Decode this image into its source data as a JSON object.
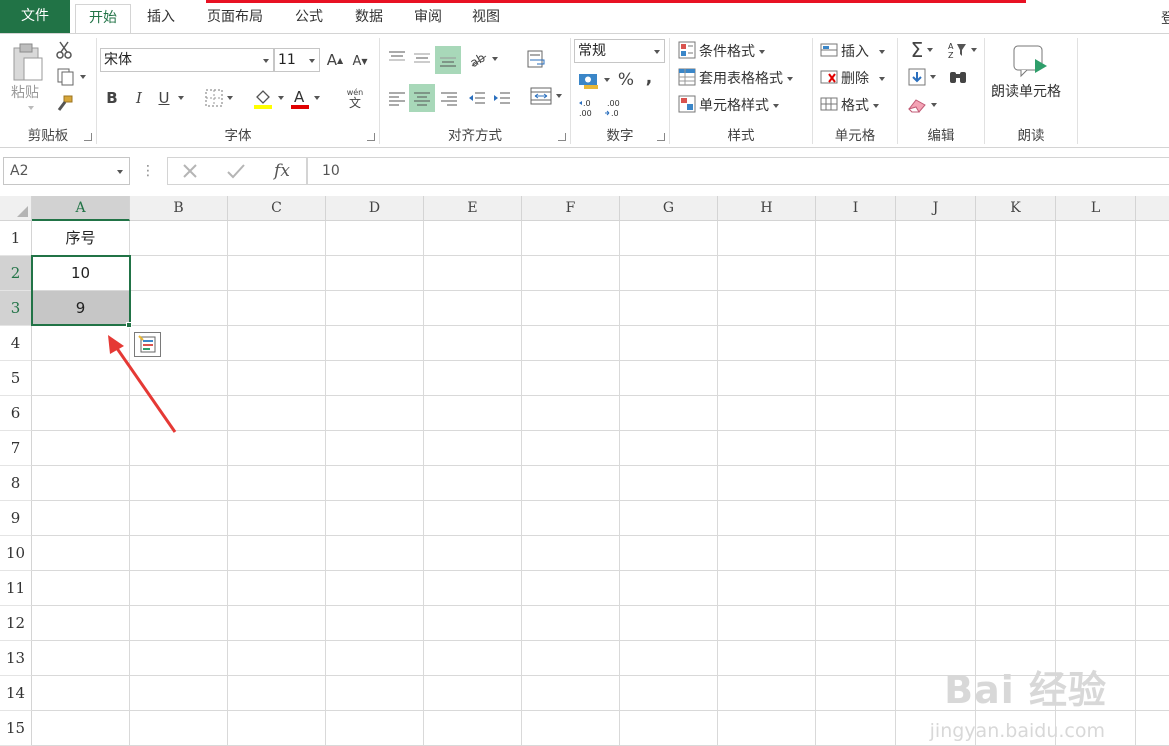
{
  "tabs": {
    "file": "文件",
    "items": [
      "开始",
      "插入",
      "页面布局",
      "公式",
      "数据",
      "审阅",
      "视图"
    ],
    "login": "登"
  },
  "ribbon": {
    "clipboard": {
      "paste": "粘贴",
      "label": "剪贴板"
    },
    "font": {
      "name": "宋体",
      "size": "11",
      "label": "字体",
      "bold": "B",
      "italic": "I",
      "underline": "U",
      "phonetic_top": "wén",
      "phonetic_bottom": "文"
    },
    "alignment": {
      "label": "对齐方式"
    },
    "number": {
      "format": "常规",
      "label": "数字",
      "percent": "%",
      "comma": ","
    },
    "styles": {
      "conditional": "条件格式",
      "table": "套用表格格式",
      "cell": "单元格样式",
      "label": "样式"
    },
    "cells": {
      "insert": "插入",
      "delete": "删除",
      "format": "格式",
      "label": "单元格"
    },
    "editing": {
      "label": "编辑"
    },
    "read": {
      "button": "朗读单元格",
      "label": "朗读"
    }
  },
  "formula_bar": {
    "name_box": "A2",
    "fx": "fx",
    "value": "10"
  },
  "sheet": {
    "columns": [
      "A",
      "B",
      "C",
      "D",
      "E",
      "F",
      "G",
      "H",
      "I",
      "J",
      "K",
      "L"
    ],
    "rows": [
      "1",
      "2",
      "3",
      "4",
      "5",
      "6",
      "7",
      "8",
      "9",
      "10",
      "11",
      "12",
      "13",
      "14",
      "15"
    ],
    "cells": {
      "A1": "序号",
      "A2": "10",
      "A3": "9"
    }
  },
  "watermark": {
    "main": "Bai 经验",
    "sub": "jingyan.baidu.com"
  },
  "colors": {
    "accent": "#217346",
    "arrow": "#e53935",
    "selection": "#c6c6c6"
  }
}
